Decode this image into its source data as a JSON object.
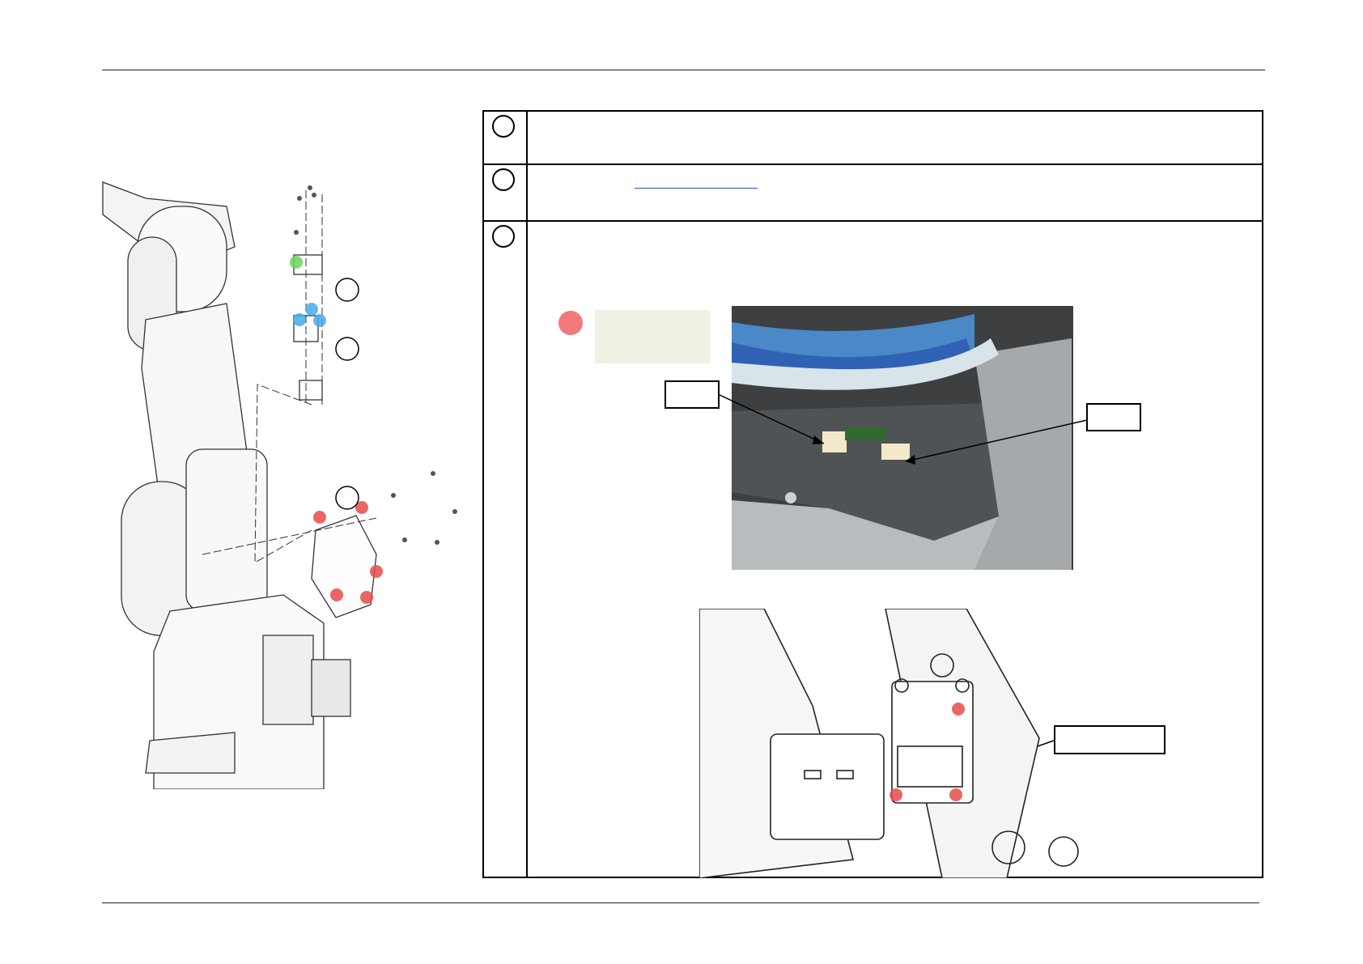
{
  "figure": {
    "step_markers": [
      "",
      "",
      ""
    ]
  },
  "steps": [
    {
      "number": "",
      "text": ""
    },
    {
      "number": "",
      "text": "",
      "link_text": ""
    },
    {
      "number": "",
      "text": ""
    }
  ],
  "note": {
    "text": ""
  },
  "callouts": {
    "photo_left": "",
    "photo_right": "",
    "drawing": ""
  },
  "colors": {
    "red_marker": "#e64b4b",
    "green_marker": "#6cd35a",
    "blue_marker": "#47a9e6",
    "note_bg": "#eef2e4",
    "link": "#1a56c8"
  }
}
